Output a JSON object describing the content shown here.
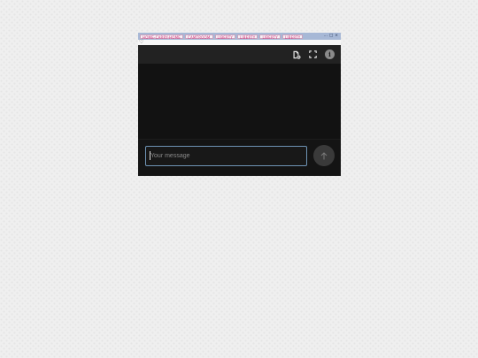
{
  "window": {
    "tabs": [
      {
        "label": "HOME-CARRY-HOME"
      },
      {
        "label": "CAMTROOM"
      },
      {
        "label": "LIBERTY"
      },
      {
        "label": "LIBERTY"
      },
      {
        "label": "LIBERTY"
      },
      {
        "label": "LIBERTY"
      }
    ],
    "controls": {
      "minimize": "…",
      "maximize": "□",
      "close": "×"
    },
    "favorite_glyph": "♡"
  },
  "toolbar": {
    "icons": [
      "document-settings-icon",
      "fullscreen-icon",
      "info-icon"
    ],
    "info_glyph": "i"
  },
  "composer": {
    "placeholder": "Your message",
    "value": ""
  },
  "colors": {
    "app_background": "#111111",
    "toolbar_background": "#222222",
    "input_border": "#6e93b4",
    "tab_text": "#d2347a",
    "tab_strip": "#a7b8d6"
  }
}
